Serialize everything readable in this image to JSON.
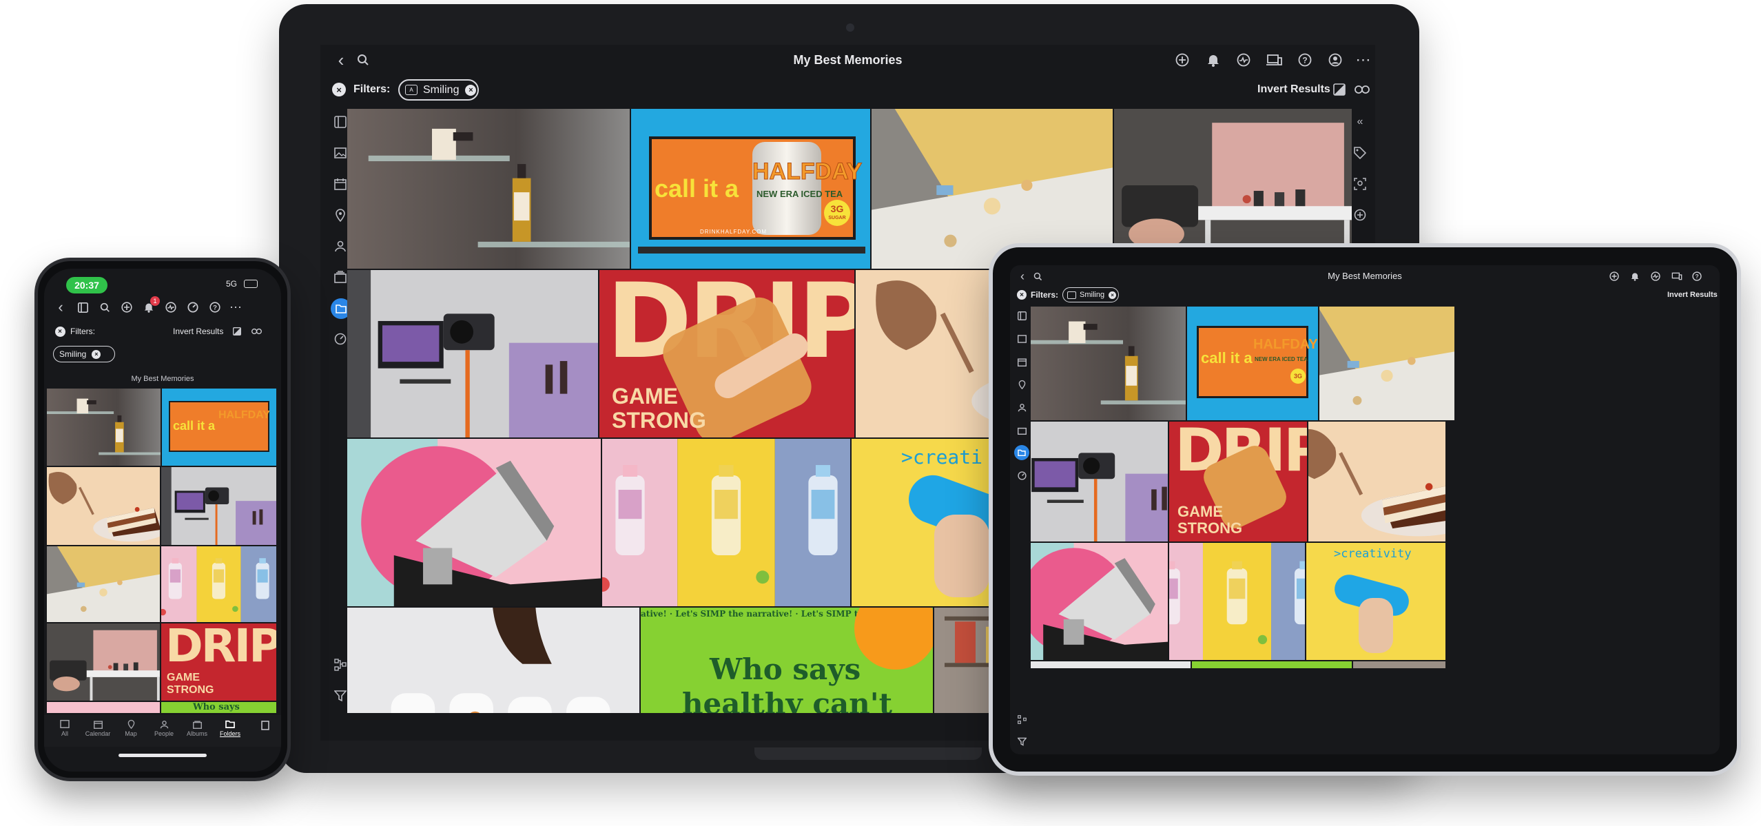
{
  "app": {
    "title": "My Best Memories",
    "filters_label": "Filters:",
    "filter_chip": "Smiling",
    "invert_results": "Invert Results",
    "accent": "#2a86e6",
    "background": "#17181b"
  },
  "phone": {
    "time": "20:37",
    "network": "5G",
    "notif_count": "1",
    "album_caption": "My Best Memories",
    "tabs": [
      {
        "label": "All",
        "icon": "image-icon"
      },
      {
        "label": "Calendar",
        "icon": "calendar-icon"
      },
      {
        "label": "Map",
        "icon": "map-pin-icon"
      },
      {
        "label": "People",
        "icon": "person-icon"
      },
      {
        "label": "Albums",
        "icon": "album-icon"
      },
      {
        "label": "Folders",
        "icon": "folder-icon",
        "active": true
      }
    ]
  },
  "tiles": {
    "halfday_line1": "call it a",
    "halfday_line2": "HALFDAY",
    "halfday_line3": "NEW ERA ICED TEA",
    "halfday_badge": "3G",
    "halfday_badge_sub": "SUGAR",
    "halfday_url": "DRINKHALFDAY.COM",
    "drip_title": "DRIP",
    "drip_sub1": "GAME",
    "drip_sub2": "STRONG",
    "creativity": ">creativity",
    "creativity_cut": ">creati",
    "who_says_1": "Who says",
    "who_says_2": "healthy can't",
    "narrative": "ative! · Let's SIMP the narrative! · Let's SIMP the narrati",
    "narrative_short": "Let's SIMP the narrative! · Let's SIMP the narrative!",
    "who_says_phone": "Who says"
  }
}
